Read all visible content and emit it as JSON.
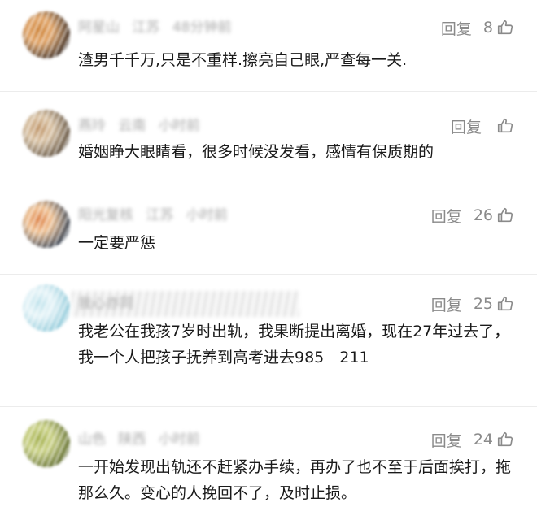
{
  "comments": [
    {
      "username": "阿星山",
      "location": "江苏",
      "time": "48分钟前",
      "reply_label": "回复",
      "likes": "8",
      "text": "渣男千千万,只是不重样.擦亮自己眼,严查每一关.",
      "avatar_colors": [
        "#3b2a1f",
        "#c97a2b",
        "#e0a060"
      ]
    },
    {
      "username": "燕玲",
      "location": "云南",
      "time": "小时前",
      "reply_label": "回复",
      "likes": "",
      "text": "婚姻睁大眼睛看，很多时候没发看，感情有保质期的",
      "avatar_colors": [
        "#5a4a38",
        "#b88a5a",
        "#d8c0a0"
      ]
    },
    {
      "username": "阳光复核",
      "location": "江苏",
      "time": "小时前",
      "reply_label": "回复",
      "likes": "26",
      "text": "一定要严惩",
      "avatar_colors": [
        "#2f3a4a",
        "#d9783a",
        "#f0c090"
      ]
    },
    {
      "username": "我心亦同",
      "location": "",
      "time": "",
      "reply_label": "回复",
      "likes": "25",
      "text": "我老公在我孩7岁时出轨，我果断提出离婚，现在27年过去了，我一个人把孩子抚养到高考进去985　211",
      "avatar_colors": [
        "#8ec9d9",
        "#b9e0ea",
        "#e6f4f8"
      ]
    },
    {
      "username": "山色",
      "location": "陕西",
      "time": "小时前",
      "reply_label": "回复",
      "likes": "24",
      "text": "一开始发现出轨还不赶紧办手续，再办了也不至于后面挨打，拖那么久。变心的人挽回不了，及时止损。",
      "avatar_colors": [
        "#5d6a2a",
        "#9aa840",
        "#c8d080"
      ]
    }
  ],
  "icons": {
    "like": "thumbs-up-icon"
  },
  "colors": {
    "meta_text": "#9a9a9a",
    "action_text": "#8a8a8a",
    "body_text": "#1a1a1a"
  }
}
